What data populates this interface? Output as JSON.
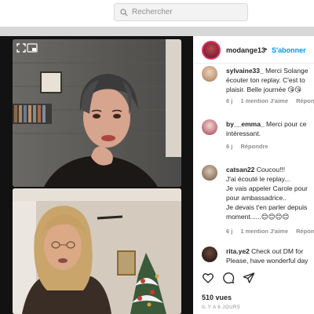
{
  "search": {
    "placeholder": "Rechercher"
  },
  "post": {
    "username": "modange13",
    "separator": "•",
    "follow_label": "S'abonner"
  },
  "comments": [
    {
      "user": "sylvaine33_",
      "lines": [
        "Merci Solange",
        "écouter ton replay. C'est to",
        "plaisir. Belle journée 😘😘"
      ],
      "meta": [
        "6 j",
        "1 mention J'aime",
        "Répon"
      ]
    },
    {
      "user": "by__emma_",
      "lines": [
        "Merci pour ce",
        "intéressant."
      ],
      "meta": [
        "6 j",
        "Répondre"
      ]
    },
    {
      "user": "catsan22",
      "lines": [
        "Coucou!!!",
        "J'ai écouté le replay...",
        "Je vais appeler Carole pour",
        "pour ambassadrice..",
        "Je devais t'en parler depuis",
        "moment......😊😊😊😊"
      ],
      "meta": [
        "6 j",
        "1 mention J'aime",
        "Répon"
      ]
    },
    {
      "user": "rita.ye2",
      "lines": [
        "Check out DM for",
        "Please, have wonderful day"
      ],
      "meta": []
    }
  ],
  "stats": {
    "views": "510 vues",
    "time_ago": "IL Y A 6 JOURS"
  },
  "colors": {
    "accent": "#0095f6",
    "ring": "#e1306c"
  },
  "icons": [
    "search-icon",
    "expand-icon",
    "picture-in-picture-icon",
    "heart-icon",
    "comment-icon",
    "share-icon"
  ]
}
